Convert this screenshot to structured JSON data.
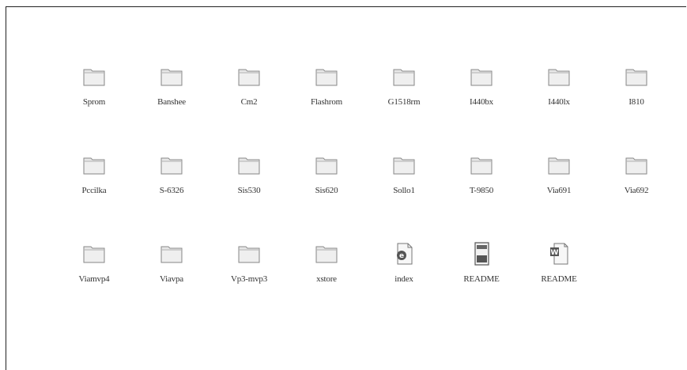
{
  "items": [
    {
      "label": "Sprom",
      "icon": "folder-icon"
    },
    {
      "label": "Banshee",
      "icon": "folder-icon"
    },
    {
      "label": "Cm2",
      "icon": "folder-icon"
    },
    {
      "label": "Flashrom",
      "icon": "folder-icon"
    },
    {
      "label": "G1518rm",
      "icon": "folder-icon"
    },
    {
      "label": "I440bx",
      "icon": "folder-icon"
    },
    {
      "label": "I440lx",
      "icon": "folder-icon"
    },
    {
      "label": "I810",
      "icon": "folder-icon"
    },
    {
      "label": "Pccilka",
      "icon": "folder-icon"
    },
    {
      "label": "S-6326",
      "icon": "folder-icon"
    },
    {
      "label": "Sis530",
      "icon": "folder-icon"
    },
    {
      "label": "Sis620",
      "icon": "folder-icon"
    },
    {
      "label": "Sollo1",
      "icon": "folder-icon"
    },
    {
      "label": "T-9850",
      "icon": "folder-icon"
    },
    {
      "label": "Via691",
      "icon": "folder-icon"
    },
    {
      "label": "Via692",
      "icon": "folder-icon"
    },
    {
      "label": "Viamvp4",
      "icon": "folder-icon"
    },
    {
      "label": "Viavpa",
      "icon": "folder-icon"
    },
    {
      "label": "Vp3-mvp3",
      "icon": "folder-icon"
    },
    {
      "label": "xstore",
      "icon": "folder-icon"
    },
    {
      "label": "index",
      "icon": "html-document-icon"
    },
    {
      "label": "README",
      "icon": "text-document-icon"
    },
    {
      "label": "README",
      "icon": "word-document-icon"
    }
  ]
}
